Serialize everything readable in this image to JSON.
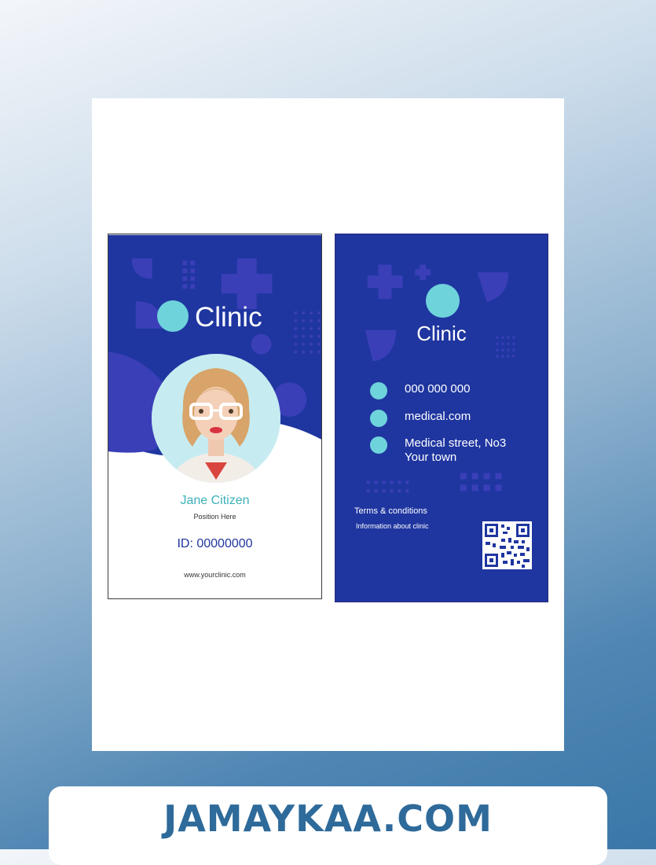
{
  "front": {
    "brand": "Clinic",
    "name": "Jane Citizen",
    "position": "Position Here",
    "id": "ID: 00000000",
    "website": "www.yourclinic.com"
  },
  "back": {
    "brand": "Clinic",
    "phone": "000 000 000",
    "email": "medical.com",
    "address_line1": "Medical street, No3",
    "address_line2": "Your town",
    "terms": "Terms & conditions",
    "about": "Information about clinic"
  },
  "footer": {
    "text": "JAMAYKAA.COM"
  },
  "colors": {
    "navy": "#1f36a0",
    "teal": "#6fd3dc",
    "name_teal": "#3db1b9"
  }
}
